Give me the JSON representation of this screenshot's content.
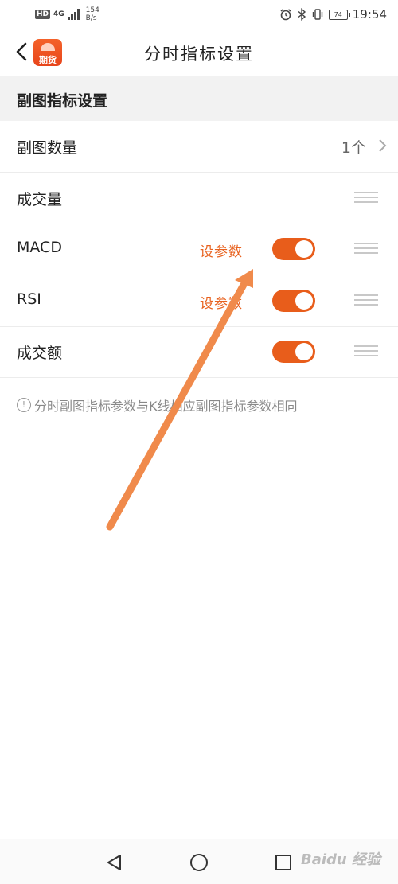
{
  "status_bar": {
    "hd_badge": "HD",
    "network": "4G",
    "net_speed_value": "154",
    "net_speed_unit": "B/s",
    "battery": "74",
    "time": "19:54"
  },
  "header": {
    "title": "分时指标设置",
    "app_logo_text": "期货"
  },
  "section": {
    "title": "副图指标设置"
  },
  "rows": [
    {
      "label": "副图数量",
      "value": "1个"
    },
    {
      "label": "成交量"
    },
    {
      "label": "MACD",
      "link": "设参数",
      "toggle_on": true
    },
    {
      "label": "RSI",
      "link": "设参数",
      "toggle_on": true
    },
    {
      "label": "成交额",
      "toggle_on": true
    }
  ],
  "note": {
    "icon": "!",
    "text": "分时副图指标参数与K线相应副图指标参数相同"
  },
  "watermark": "Baidu 经验",
  "colors": {
    "accent": "#e85d1b",
    "arrow": "#f08a4b"
  },
  "icons": [
    "back-chevron-icon",
    "chevron-right-icon",
    "drag-handle-icon",
    "info-icon",
    "nav-back-icon",
    "nav-home-icon",
    "nav-recents-icon"
  ]
}
